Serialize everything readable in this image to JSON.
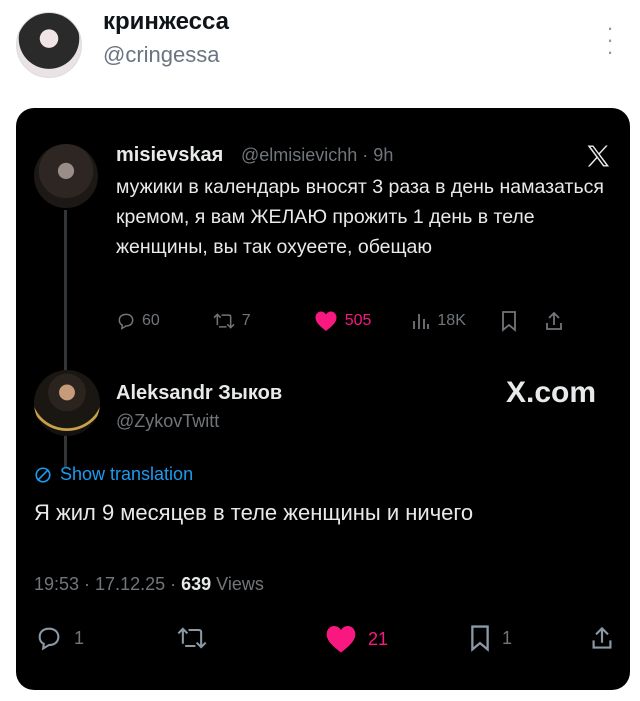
{
  "outer": {
    "name": "кринжесса",
    "handle": "@cringessa"
  },
  "quoted": {
    "name": "misievskaя",
    "handle": "@elmisievichh · 9h",
    "text": "мужики в календарь вносят 3 раза в день намазаться кремом, я вам ЖЕЛАЮ прожить 1 день в теле женщины, вы так охуеете, обещаю",
    "replies": "60",
    "reposts": "7",
    "likes": "505",
    "views": "18K"
  },
  "reply": {
    "name": "Aleksandr Зыков",
    "handle": "@ZykovTwitt",
    "brand": "X.com",
    "translate_label": "Show translation",
    "text": "Я жил 9 месяцев в теле женщины и ничего",
    "time_date": "19:53 · 17.12.25 · ",
    "views_count": "639",
    "views_label": " Views",
    "replies": "1",
    "likes": "21",
    "bookmarks": "1"
  },
  "colors": {
    "accent_blue": "#1d9bf0",
    "like_pink": "#f91880",
    "muted": "#71767b"
  },
  "icons": [
    "more-icon",
    "x-logo-icon",
    "reply-icon",
    "repost-icon",
    "like-icon",
    "views-icon",
    "bookmark-icon",
    "share-icon",
    "translate-icon"
  ]
}
